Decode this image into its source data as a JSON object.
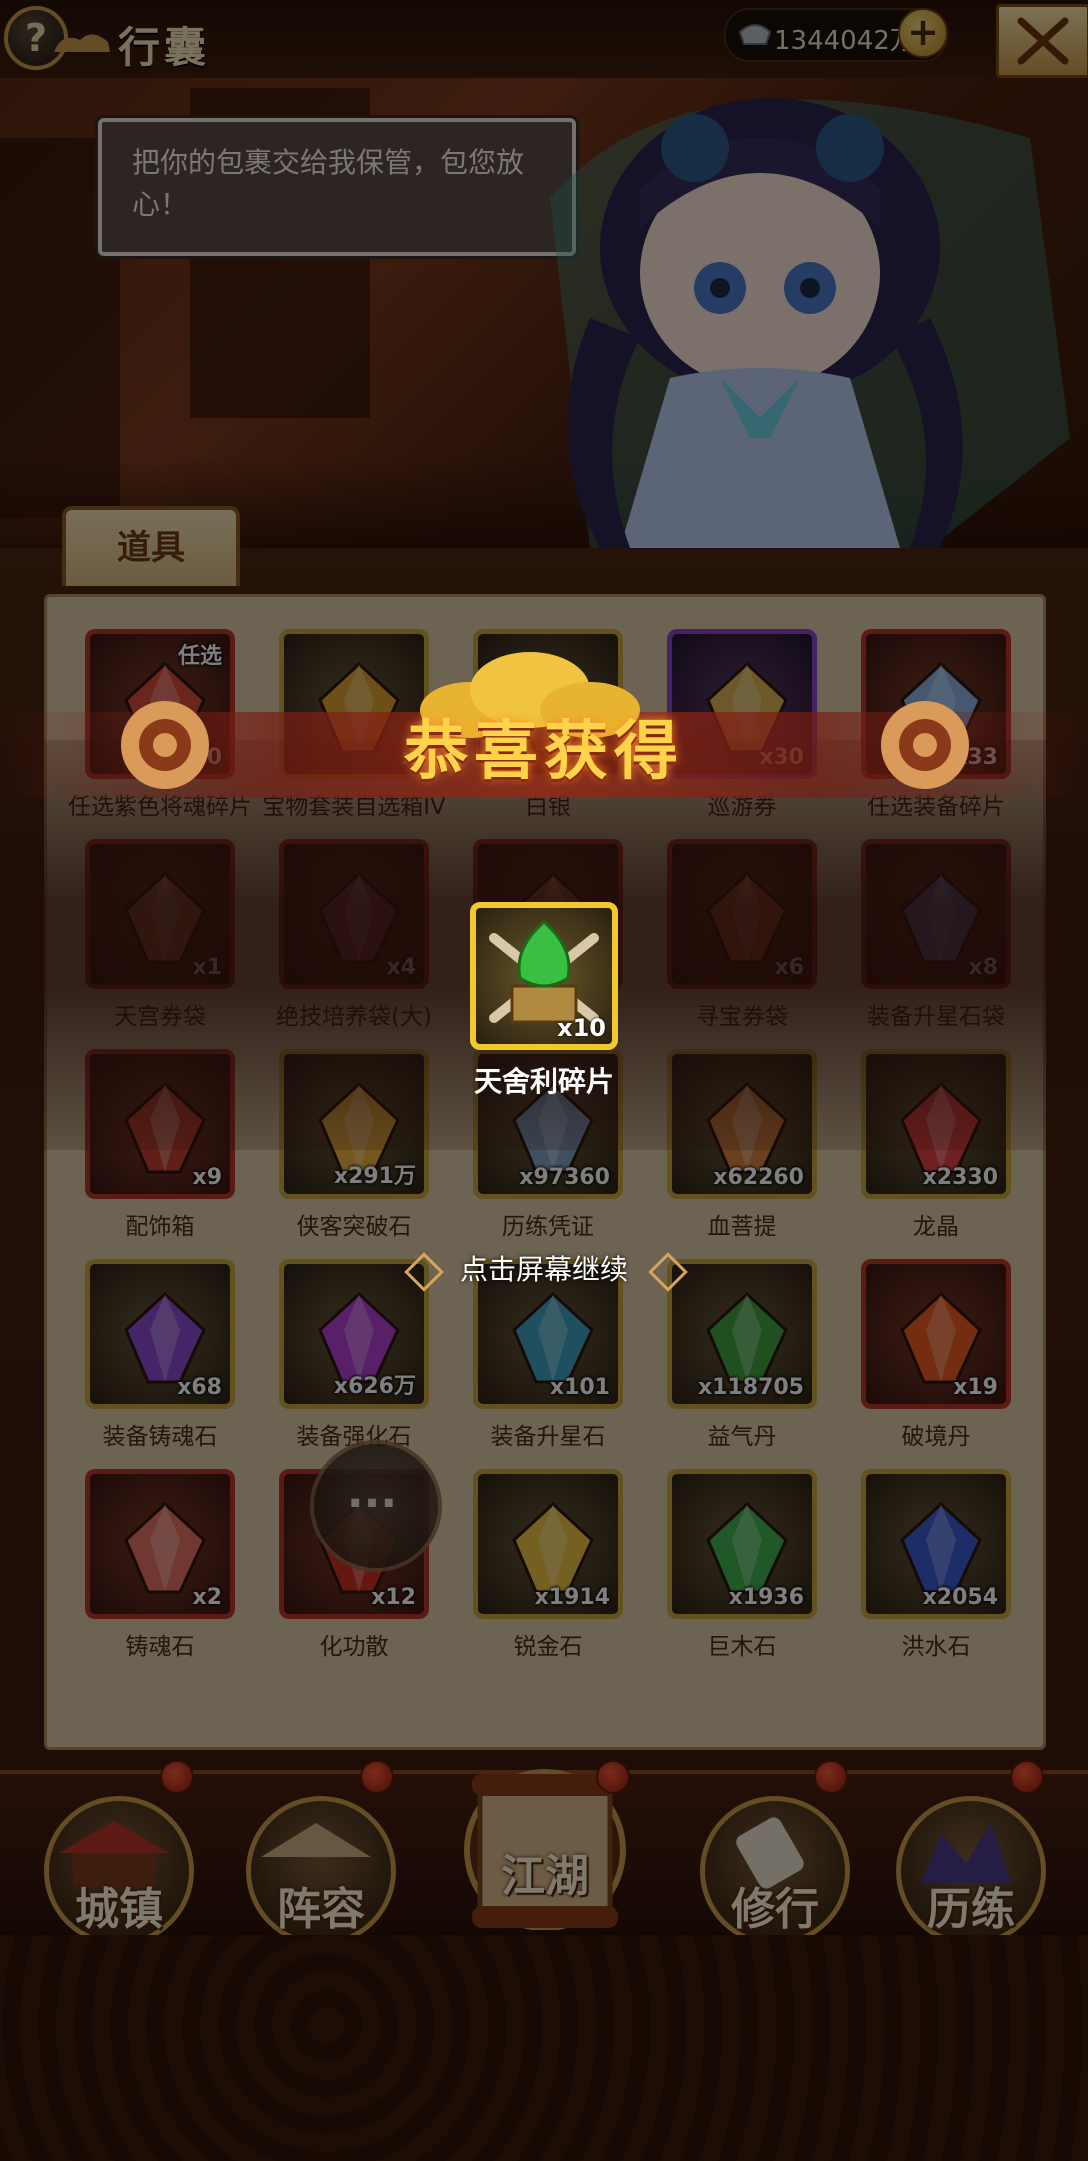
{
  "header": {
    "help_symbol": "?",
    "title": "行囊",
    "currency_value": "1344042万",
    "plus_symbol": "+",
    "close_icon": "crossed-swords-icon"
  },
  "banner": {
    "speech": "把你的包裹交给我保管，包您放心！"
  },
  "tabs": {
    "items": "道具"
  },
  "inventory": [
    {
      "name": "任选紫色将魂碎片",
      "count": "1500",
      "frame": "red",
      "badge": "任选"
    },
    {
      "name": "宝物套装自选箱IV",
      "count": "x",
      "frame": "gold"
    },
    {
      "name": "白银",
      "count": "",
      "frame": "gold"
    },
    {
      "name": "巡游券",
      "count": "x30",
      "frame": "purple"
    },
    {
      "name": "任选装备碎片",
      "count": "x33",
      "frame": "red"
    },
    {
      "name": "天宫券袋",
      "count": "x1",
      "frame": "red"
    },
    {
      "name": "绝技培养袋(大)",
      "count": "x4",
      "frame": "red"
    },
    {
      "name": "",
      "count": "",
      "frame": "red"
    },
    {
      "name": "寻宝券袋",
      "count": "x6",
      "frame": "red"
    },
    {
      "name": "装备升星石袋",
      "count": "x8",
      "frame": "red"
    },
    {
      "name": "配饰箱",
      "count": "x9",
      "frame": "red"
    },
    {
      "name": "侠客突破石",
      "count": "x291万",
      "frame": "gold"
    },
    {
      "name": "历练凭证",
      "count": "x97360",
      "frame": "gold"
    },
    {
      "name": "血菩提",
      "count": "x62260",
      "frame": "gold"
    },
    {
      "name": "龙晶",
      "count": "x2330",
      "frame": "gold"
    },
    {
      "name": "装备铸魂石",
      "count": "x68",
      "frame": "gold"
    },
    {
      "name": "装备强化石",
      "count": "x626万",
      "frame": "gold"
    },
    {
      "name": "装备升星石",
      "count": "x101",
      "frame": "gold"
    },
    {
      "name": "益气丹",
      "count": "x118705",
      "frame": "gold"
    },
    {
      "name": "破境丹",
      "count": "x19",
      "frame": "red"
    },
    {
      "name": "铸魂石",
      "count": "x2",
      "frame": "red"
    },
    {
      "name": "化功散",
      "count": "x12",
      "frame": "red"
    },
    {
      "name": "锐金石",
      "count": "x1914",
      "frame": "gold"
    },
    {
      "name": "巨木石",
      "count": "x1936",
      "frame": "gold"
    },
    {
      "name": "洪水石",
      "count": "x2054",
      "frame": "gold"
    }
  ],
  "reward_popup": {
    "title": "恭喜获得",
    "item_name": "天舍利碎片",
    "item_count": "x10",
    "continue_hint": "点击屏幕继续"
  },
  "chat": {
    "icon": "chat-bubble-icon",
    "dots": "···"
  },
  "nav": [
    {
      "label": "城镇",
      "icon": "town-icon"
    },
    {
      "label": "阵容",
      "icon": "lineup-icon"
    },
    {
      "label": "江湖",
      "icon": "scroll-icon"
    },
    {
      "label": "修行",
      "icon": "training-icon"
    },
    {
      "label": "历练",
      "icon": "trial-icon"
    }
  ],
  "colors": {
    "red_frame": "#b9342a",
    "gold_frame": "#c8a43c",
    "purple_frame": "#8a44c8",
    "title_gold": "#ffd34a"
  }
}
